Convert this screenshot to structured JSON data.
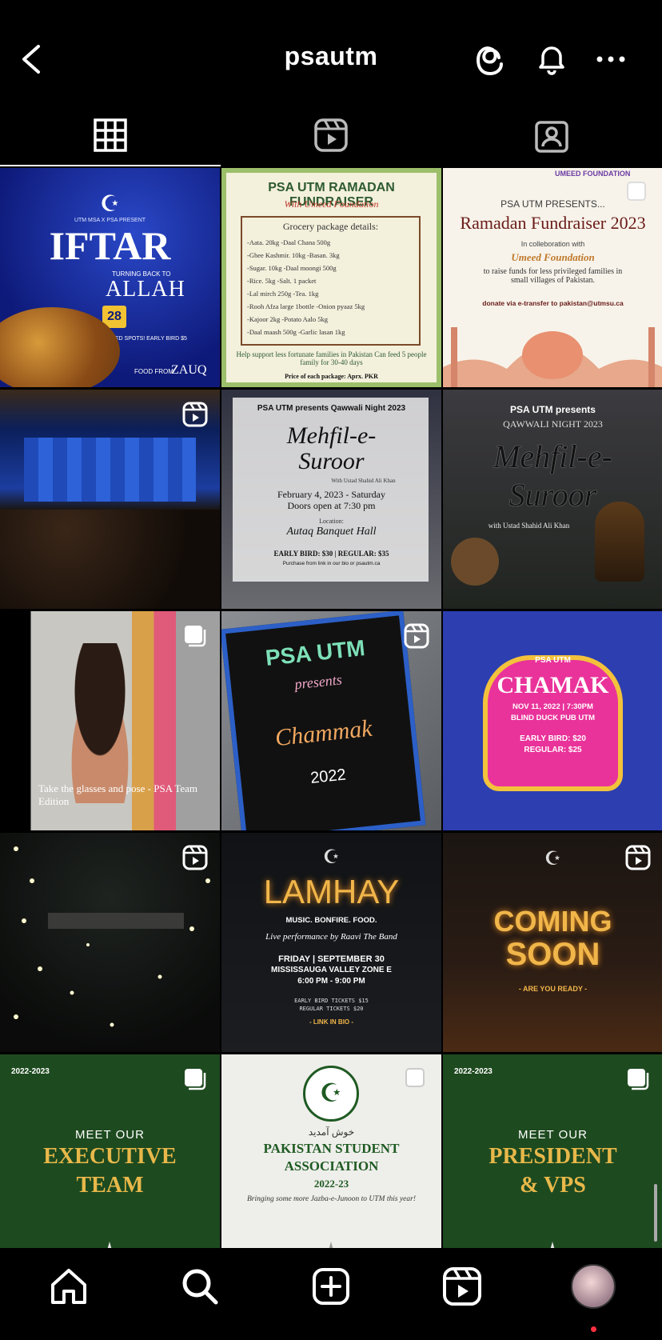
{
  "header": {
    "username": "psautm"
  },
  "tabs": [
    "grid-icon",
    "reels-icon",
    "tagged-icon"
  ],
  "posts": {
    "iftar": {
      "top": "UTM MSA X PSA PRESENT",
      "title": "IFTAR",
      "sub": "TURNING BACK TO",
      "sub2": "ALLAH",
      "date": "28",
      "note": "LIMITED SPOTS! EARLY BIRD $5",
      "food": "FOOD FROM",
      "brand": "ZAUQ"
    },
    "fund1": {
      "title": "PSA UTM RAMADAN FUNDRAISER",
      "with": "With Umeed Foundation",
      "box": "Grocery package details:",
      "items": [
        "-Aata. 20kg  -Daal Chana 500g",
        "-Ghee Kashmir. 10kg -Basan. 3kg",
        "-Sugar. 10kg -Daal moongi 500g",
        "-Rice. 5kg -Salt. 1 packet",
        "-Lal mirch 250g -Tea. 1kg",
        "-Rooh Afza large 1bottle -Onion pyaaz 5kg",
        "-Kajoor 2kg -Potato Aalo 5kg",
        "-Daal maash 500g -Garlic lasan 1kg"
      ],
      "foot": "Help support less fortunate families in Pakistan Can feed 5 people family for 30-40 days",
      "price": "Price of each package: Aprx. PKR"
    },
    "fund2": {
      "logo": "UMEED FOUNDATION",
      "presents": "PSA UTM PRESENTS...",
      "title": "Ramadan Fundraiser 2023",
      "collab": "In colleboration with",
      "org": "Umeed Foundation",
      "raise": "to raise funds for less privileged families in small villages of Pakistan.",
      "donate": "donate via e-transfer to pakistan@utmsu.ca"
    },
    "mehfil1": {
      "top": "PSA UTM presents Qawwali Night 2023",
      "title": "Mehfil-e-Suroor",
      "with": "With Ustad Shahid Ali Khan",
      "date": "February 4, 2023 - Saturday",
      "doors": "Doors open at 7:30 pm",
      "loc": "Location:",
      "venue": "Autaq Banquet Hall",
      "price": "EARLY BIRD: $30 | REGULAR: $35",
      "buy": "Purchase from link in our bio or psautm.ca"
    },
    "mehfil2": {
      "top": "PSA UTM presents",
      "night": "QAWWALI NIGHT 2023",
      "title": "Mehfil-e-Suroor",
      "with": "with Ustad Shahid Ali Khan"
    },
    "selfie": {
      "caption": "Take the glasses and pose - PSA Team Edition"
    },
    "board": {
      "l1": "PSA UTM",
      "l2": "presents",
      "l3": "Chammak",
      "l4": "2022"
    },
    "chamak": {
      "top": "PSA UTM",
      "title": "CHAMAK",
      "date": "NOV 11, 2022 | 7:30PM",
      "venue": "BLIND DUCK PUB UTM",
      "early": "EARLY BIRD: $20",
      "regular": "REGULAR: $25"
    },
    "lamhay": {
      "title": "LAMHAY",
      "tag": "MUSIC. BONFIRE. FOOD.",
      "live": "Live performance by Raavi The Band",
      "date": "FRIDAY | SEPTEMBER 30",
      "place": "MISSISSAUGA VALLEY ZONE E",
      "time": "6:00 PM - 9:00 PM",
      "t1": "EARLY BIRD TICKETS $15",
      "t2": "REGULAR TICKETS $20",
      "link": "- LINK IN BIO -"
    },
    "soon": {
      "l1": "COMING",
      "l2": "SOON",
      "ready": "- ARE YOU READY -"
    },
    "exec": {
      "year": "2022-2023",
      "meet": "MEET OUR",
      "l1": "EXECUTIVE",
      "l2": "TEAM"
    },
    "psa": {
      "welcome": "خوش آمدید",
      "l1": "PAKISTAN STUDENT",
      "l2": "ASSOCIATION",
      "year": "2022-23",
      "tag": "Bringing some more Jazba-e-Junoon to UTM this year!"
    },
    "pres": {
      "year": "2022-2023",
      "meet": "MEET OUR",
      "l1": "PRESIDENT",
      "l2": "& VPS"
    }
  },
  "nav": [
    "home-icon",
    "search-icon",
    "create-icon",
    "reels-icon",
    "profile-avatar"
  ],
  "colors": {
    "gold": "#e8b84a",
    "green": "#1e4a1f",
    "brandBlue": "#2a48c8"
  }
}
